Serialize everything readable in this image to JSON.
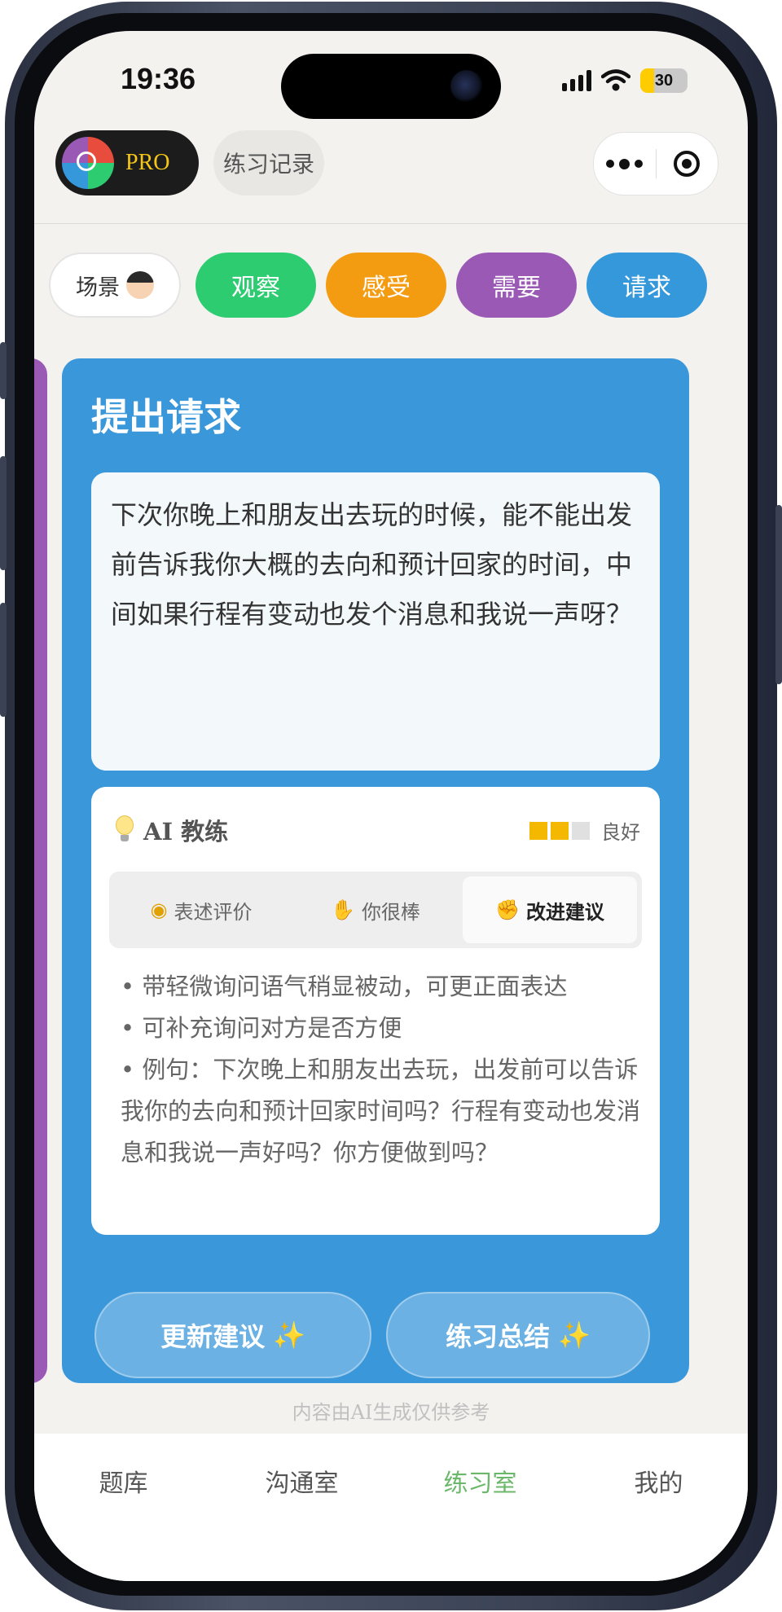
{
  "status_bar": {
    "time": "19:36",
    "battery": "30"
  },
  "header": {
    "pro_label": "PRO",
    "record_label": "练习记录"
  },
  "steps": [
    {
      "label": "场景"
    },
    {
      "label": "观察"
    },
    {
      "label": "感受"
    },
    {
      "label": "需要"
    },
    {
      "label": "请求"
    }
  ],
  "card": {
    "title": "提出请求",
    "request_text": "下次你晚上和朋友出去玩的时候，能不能出发前告诉我你大概的去向和预计回家的时间，中间如果行程有变动也发个消息和我说一声呀？"
  },
  "coach": {
    "title": "AI 教练",
    "rating_label": "良好",
    "rating_value": "2/3",
    "tabs": [
      {
        "label": "表述评价",
        "icon": "medal-icon"
      },
      {
        "label": "你很棒",
        "icon": "thumbs-up-icon"
      },
      {
        "label": "改进建议",
        "icon": "muscle-icon"
      }
    ],
    "active_tab": "改进建议",
    "advice": [
      "• 带轻微询问语气稍显被动，可更正面表达",
      "• 可补充询问对方是否方便",
      "• 例句：下次晚上和朋友出去玩，出发前可以告诉我你的去向和预计回家时间吗？行程有变动也发消息和我说一声好吗？你方便做到吗？"
    ]
  },
  "actions": {
    "update_label": "更新建议",
    "summary_label": "练习总结"
  },
  "disclaimer": "内容由AI生成仅供参考",
  "nav": [
    {
      "label": "题库"
    },
    {
      "label": "沟通室"
    },
    {
      "label": "练习室"
    },
    {
      "label": "我的"
    }
  ],
  "colors": {
    "observe": "#2ecc71",
    "feel": "#f39c12",
    "need": "#9b59b6",
    "request": "#3498db",
    "card": "#3a97da",
    "nav_active": "#6bb86b",
    "pro_text": "#f5c518"
  }
}
